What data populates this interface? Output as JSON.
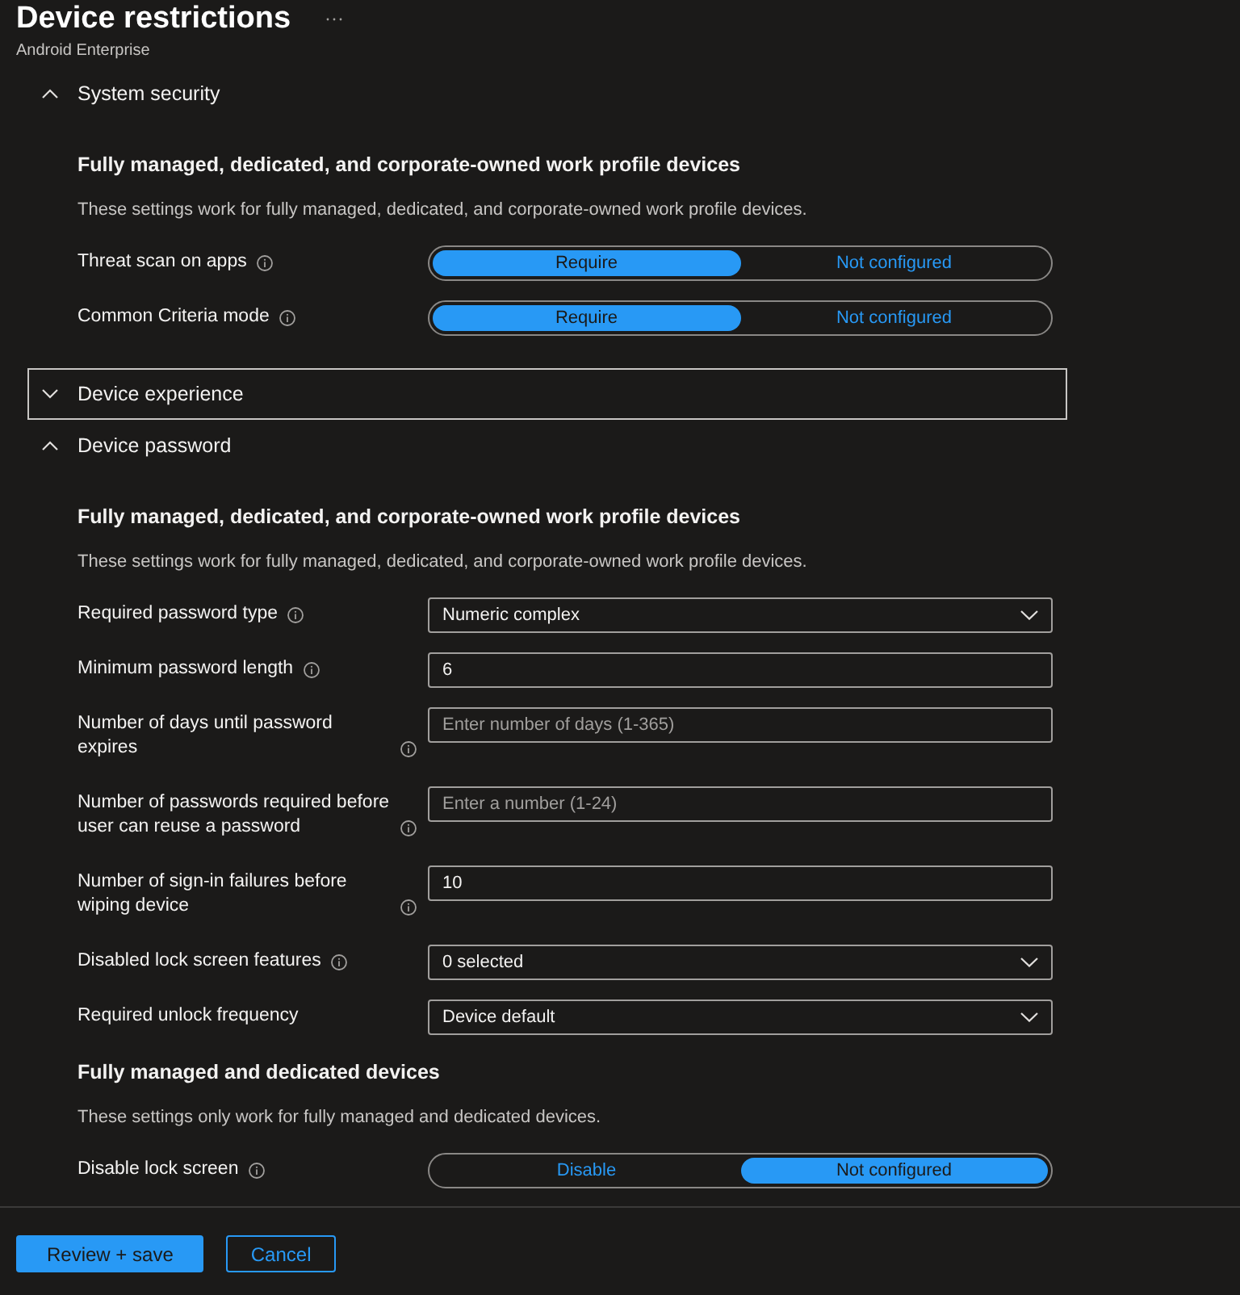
{
  "header": {
    "title": "Device restrictions",
    "subtitle": "Android Enterprise"
  },
  "sections": [
    {
      "title": "System security",
      "expanded": true,
      "focused": false,
      "groups": [
        {
          "heading": "Fully managed, dedicated, and corporate-owned work profile devices",
          "description": "These settings work for fully managed, dedicated, and corporate-owned work profile devices.",
          "settings": [
            {
              "kind": "toggle",
              "label": "Threat scan on apps",
              "info": true,
              "options": [
                {
                  "label": "Require",
                  "selected": true
                },
                {
                  "label": "Not configured",
                  "selected": false
                }
              ]
            },
            {
              "kind": "toggle",
              "label": "Common Criteria mode",
              "info": true,
              "options": [
                {
                  "label": "Require",
                  "selected": true
                },
                {
                  "label": "Not configured",
                  "selected": false
                }
              ]
            }
          ]
        }
      ]
    },
    {
      "title": "Device experience",
      "expanded": false,
      "focused": true
    },
    {
      "title": "Device password",
      "expanded": true,
      "focused": false,
      "groups": [
        {
          "heading": "Fully managed, dedicated, and corporate-owned work profile devices",
          "description": "These settings work for fully managed, dedicated, and corporate-owned work profile devices.",
          "settings": [
            {
              "kind": "dropdown",
              "label": "Required password type",
              "info": true,
              "value": "Numeric complex"
            },
            {
              "kind": "text",
              "label": "Minimum password length",
              "info": true,
              "value": "6"
            },
            {
              "kind": "text",
              "label": "Number of days until password expires",
              "info": true,
              "placeholder": "Enter number of days (1-365)"
            },
            {
              "kind": "text",
              "label": "Number of passwords required before user can reuse a password",
              "info": true,
              "placeholder": "Enter a number (1-24)"
            },
            {
              "kind": "text",
              "label": "Number of sign-in failures before wiping device",
              "info": true,
              "value": "10"
            },
            {
              "kind": "dropdown",
              "label": "Disabled lock screen features",
              "info": true,
              "value": "0 selected"
            },
            {
              "kind": "dropdown",
              "label": "Required unlock frequency",
              "info": false,
              "value": "Device default"
            }
          ]
        },
        {
          "heading": "Fully managed and dedicated devices",
          "description": "These settings only work for fully managed and dedicated devices.",
          "settings": [
            {
              "kind": "toggle",
              "label": "Disable lock screen",
              "info": true,
              "options": [
                {
                  "label": "Disable",
                  "selected": false
                },
                {
                  "label": "Not configured",
                  "selected": true
                }
              ]
            }
          ]
        }
      ]
    }
  ],
  "footer": {
    "buttons": [
      {
        "label": "Review + save",
        "kind": "primary"
      },
      {
        "label": "Cancel",
        "kind": "secondary"
      }
    ]
  }
}
